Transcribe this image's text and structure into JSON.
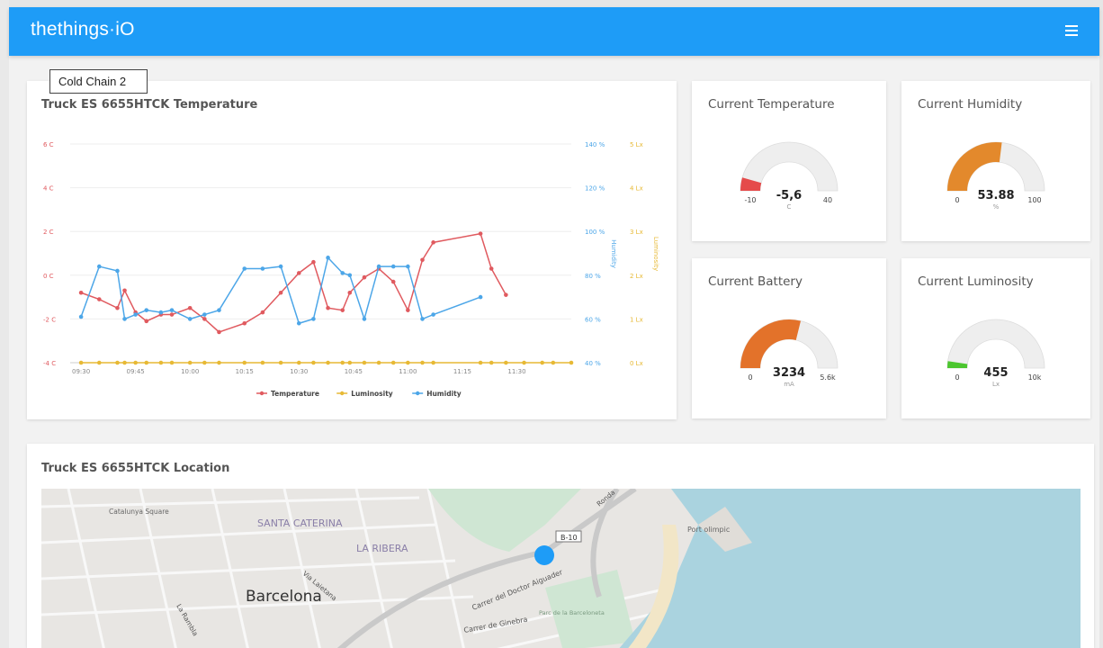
{
  "app": {
    "logo_text": "thethings",
    "logo_suffix": "iO",
    "tooltip": "Cold Chain 2"
  },
  "colors": {
    "brand": "#1e9cf7",
    "temperature": "#e05a5f",
    "luminosity": "#e7b935",
    "humidity": "#4ca6e8",
    "gauge_track": "#eeeeee",
    "gauge_temperature": "#e54b4b",
    "gauge_humidity": "#e3892c",
    "gauge_battery": "#e3722a",
    "gauge_luminosity": "#4cc62f"
  },
  "chart_card": {
    "title": "Truck ES 6655HTCK Temperature"
  },
  "chart_data": {
    "type": "line",
    "x": [
      "09:30",
      "09:35",
      "09:40",
      "09:42",
      "09:45",
      "09:48",
      "09:52",
      "09:55",
      "10:00",
      "10:04",
      "10:08",
      "10:15",
      "10:20",
      "10:25",
      "10:30",
      "10:34",
      "10:38",
      "10:42",
      "10:44",
      "10:48",
      "10:52",
      "10:56",
      "11:00",
      "11:04",
      "11:07",
      "11:20",
      "11:23",
      "11:27",
      "11:32",
      "11:37",
      "11:40",
      "11:45"
    ],
    "x_ticks": [
      "09:30",
      "09:45",
      "10:00",
      "10:15",
      "10:30",
      "10:45",
      "11:00",
      "11:15",
      "11:30"
    ],
    "series": [
      {
        "name": "Temperature",
        "axis": "left",
        "values": [
          -0.8,
          -1.1,
          -1.5,
          -0.7,
          -1.7,
          -2.1,
          -1.8,
          -1.8,
          -1.5,
          -2.0,
          -2.6,
          -2.2,
          -1.7,
          -0.8,
          0.1,
          0.6,
          -1.5,
          -1.6,
          -0.8,
          -0.1,
          0.3,
          -0.3,
          -1.6,
          0.7,
          1.5,
          1.9,
          0.3,
          -0.9,
          null,
          null,
          null,
          null
        ]
      },
      {
        "name": "Luminosity",
        "axis": "right2",
        "values": [
          0,
          0,
          0,
          0,
          0,
          0,
          0,
          0,
          0,
          0,
          0,
          0,
          0,
          0,
          0,
          0,
          0,
          0,
          0,
          0,
          0,
          0,
          0,
          0,
          0,
          0,
          0,
          0,
          0,
          0,
          0,
          0
        ]
      },
      {
        "name": "Humidity",
        "axis": "right1",
        "values": [
          61,
          84,
          82,
          60,
          62,
          64,
          63,
          64,
          60,
          62,
          64,
          83,
          83,
          84,
          58,
          60,
          88,
          81,
          80,
          60,
          84,
          84,
          84,
          60,
          62,
          70,
          null,
          null,
          null,
          null,
          null,
          null
        ]
      }
    ],
    "left_axis": {
      "ticks": [
        "-4 C",
        "-2 C",
        "0 C",
        "2 C",
        "4 C",
        "6 C"
      ],
      "range": [
        -4,
        6
      ]
    },
    "right_axis_1": {
      "label": "Humidity",
      "ticks": [
        "40 %",
        "60 %",
        "80 %",
        "100 %",
        "120 %",
        "140 %"
      ],
      "range": [
        40,
        140
      ]
    },
    "right_axis_2": {
      "label": "Luminosity",
      "ticks": [
        "0 Lx",
        "1 Lx",
        "2 Lx",
        "3 Lx",
        "4 Lx",
        "5 Lx"
      ],
      "range": [
        0,
        5
      ]
    },
    "legend": [
      "Temperature",
      "Luminosity",
      "Humidity"
    ],
    "legend_position": "bottom-center",
    "grid": true
  },
  "gauges": [
    {
      "title": "Current Temperature",
      "value": "-5,6",
      "value_num": -5.6,
      "min": "-10",
      "max": "40",
      "min_num": -10,
      "max_num": 40,
      "unit": "C",
      "color_key": "gauge_temperature"
    },
    {
      "title": "Current Humidity",
      "value": "53.88",
      "value_num": 53.88,
      "min": "0",
      "max": "100",
      "min_num": 0,
      "max_num": 100,
      "unit": "%",
      "color_key": "gauge_humidity"
    },
    {
      "title": "Current Battery",
      "value": "3234",
      "value_num": 3234,
      "min": "0",
      "max": "5.6k",
      "min_num": 0,
      "max_num": 5600,
      "unit": "mA",
      "color_key": "gauge_battery"
    },
    {
      "title": "Current Luminosity",
      "value": "455",
      "value_num": 455,
      "min": "0",
      "max": "10k",
      "min_num": 0,
      "max_num": 10000,
      "unit": "Lx",
      "color_key": "gauge_luminosity"
    }
  ],
  "map_card": {
    "title": "Truck ES 6655HTCK Location",
    "labels": [
      "Barcelona",
      "SANTA CATERINA",
      "LA RIBERA",
      "Catalunya Square",
      "Port olimpic",
      "B-10",
      "Carrer del Doctor Aiguader",
      "Carrer de Ginebra",
      "Parc de la Barceloneta",
      "Via Laietana",
      "La Rambla",
      "Ronda"
    ]
  }
}
